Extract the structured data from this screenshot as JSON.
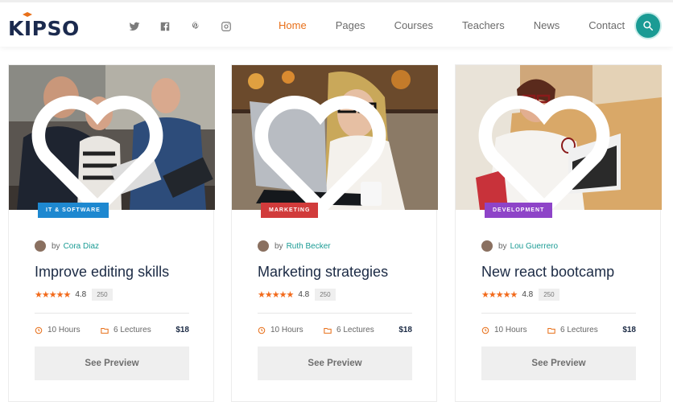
{
  "header": {
    "logo": "KIPSO",
    "socials": [
      "twitter-icon",
      "facebook-icon",
      "pinterest-icon",
      "instagram-icon"
    ],
    "nav": [
      {
        "label": "Home",
        "active": true
      },
      {
        "label": "Pages",
        "active": false
      },
      {
        "label": "Courses",
        "active": false
      },
      {
        "label": "Teachers",
        "active": false
      },
      {
        "label": "News",
        "active": false
      },
      {
        "label": "Contact",
        "active": false
      }
    ],
    "search_icon": "search-icon"
  },
  "colors": {
    "accent": "#e8701a",
    "teal": "#1a9b94",
    "badge_it": "#1e88d0",
    "badge_marketing": "#d13b3b",
    "badge_dev": "#8e44c8"
  },
  "courses": [
    {
      "category": "IT & SOFTWARE",
      "by": "by",
      "author": "Cora Diaz",
      "title": "Improve editing skills",
      "rating": "4.8",
      "reviews": "250",
      "hours": "10 Hours",
      "lectures": "6 Lectures",
      "price": "$18",
      "button": "See Preview"
    },
    {
      "category": "MARKETING",
      "by": "by",
      "author": "Ruth Becker",
      "title": "Marketing strategies",
      "rating": "4.8",
      "reviews": "250",
      "hours": "10 Hours",
      "lectures": "6 Lectures",
      "price": "$18",
      "button": "See Preview"
    },
    {
      "category": "DEVELOPMENT",
      "by": "by",
      "author": "Lou Guerrero",
      "title": "New react bootcamp",
      "rating": "4.8",
      "reviews": "250",
      "hours": "10 Hours",
      "lectures": "6 Lectures",
      "price": "$18",
      "button": "See Preview"
    }
  ]
}
